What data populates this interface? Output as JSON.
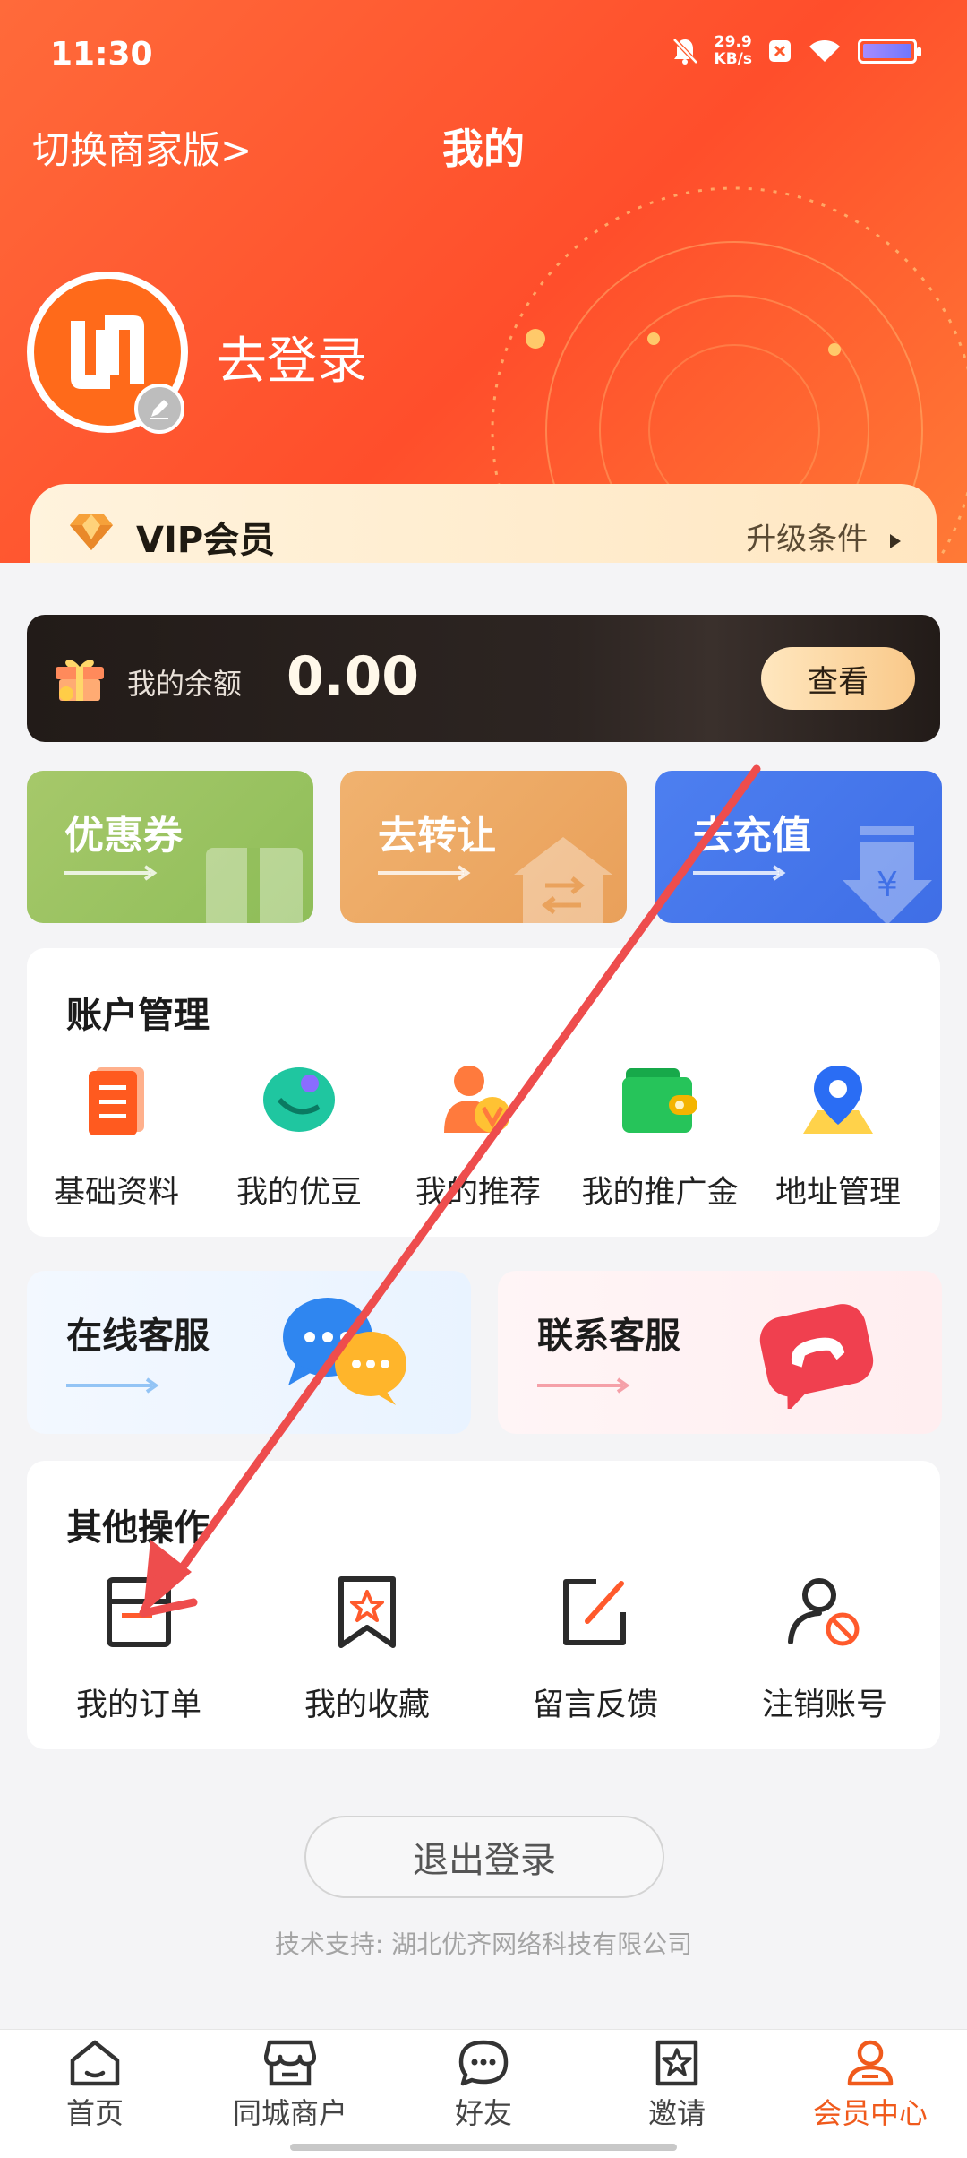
{
  "status_bar": {
    "time": "11:30",
    "net_speed_value": "29.9",
    "net_speed_unit": "KB/s"
  },
  "header": {
    "switch_merchant": "切换商家版>",
    "title": "我的",
    "login": "去登录"
  },
  "vip": {
    "label": "VIP会员",
    "upgrade": "升级条件"
  },
  "balance": {
    "label": "我的余额",
    "value": "0.00",
    "button": "查看"
  },
  "quick_actions": [
    {
      "label": "优惠券",
      "color": "#9cc461"
    },
    {
      "label": "去转让",
      "color": "#eca865"
    },
    {
      "label": "去充值",
      "color": "#4676ec"
    }
  ],
  "account": {
    "title": "账户管理",
    "items": [
      {
        "label": "基础资料",
        "icon": "profile-doc-icon"
      },
      {
        "label": "我的优豆",
        "icon": "bean-icon"
      },
      {
        "label": "我的推荐",
        "icon": "referral-user-icon"
      },
      {
        "label": "我的推广金",
        "icon": "wallet-icon"
      },
      {
        "label": "地址管理",
        "icon": "location-pin-icon"
      }
    ]
  },
  "services": {
    "online": "在线客服",
    "contact": "联系客服"
  },
  "other": {
    "title": "其他操作",
    "items": [
      {
        "label": "我的订单",
        "icon": "order-icon"
      },
      {
        "label": "我的收藏",
        "icon": "bookmark-icon"
      },
      {
        "label": "留言反馈",
        "icon": "feedback-edit-icon"
      },
      {
        "label": "注销账号",
        "icon": "cancel-account-icon"
      }
    ]
  },
  "logout": "退出登录",
  "tech_support": "技术支持: 湖北优齐网络科技有限公司",
  "nav": [
    {
      "label": "首页",
      "icon": "home-icon"
    },
    {
      "label": "同城商户",
      "icon": "store-icon"
    },
    {
      "label": "好友",
      "icon": "chat-icon"
    },
    {
      "label": "邀请",
      "icon": "invite-star-icon"
    },
    {
      "label": "会员中心",
      "icon": "member-icon",
      "active": true
    }
  ],
  "colors": {
    "accent": "#ff5a2c",
    "active_nav": "#f05a1c",
    "annotation_arrow": "#ee4d4d"
  }
}
